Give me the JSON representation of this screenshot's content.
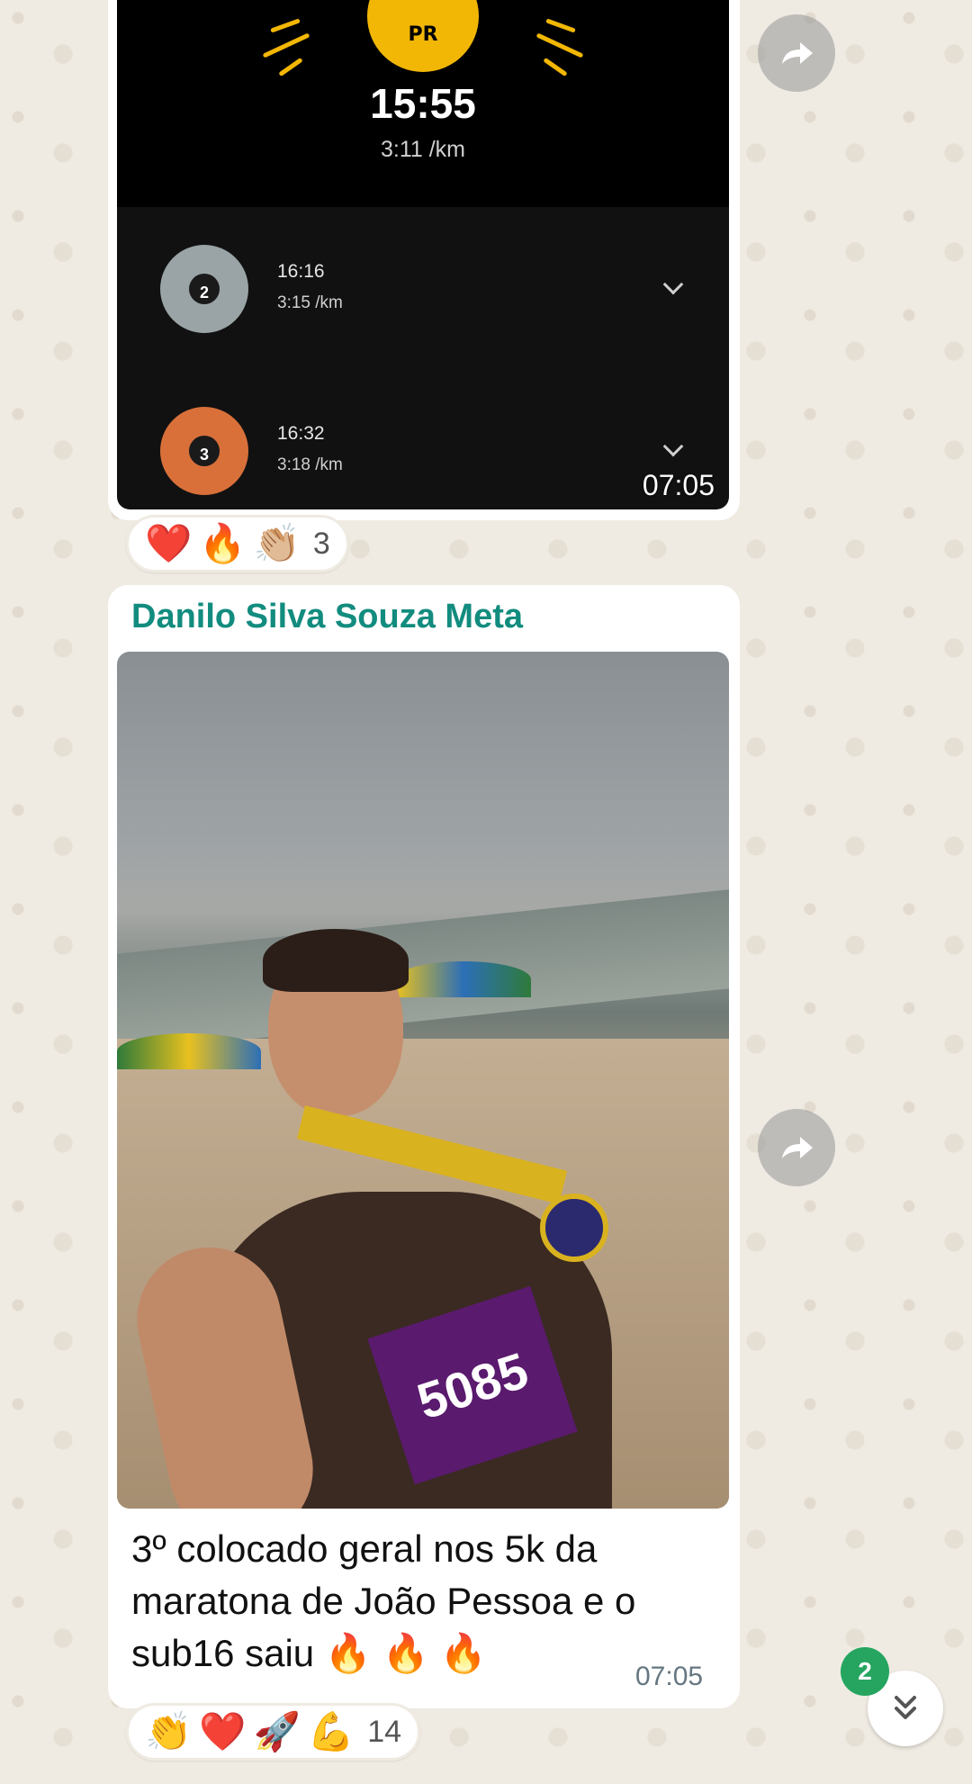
{
  "message1": {
    "stats": {
      "badge_label": "PR",
      "best_time": "15:55",
      "best_pace": "3:11 /km",
      "rows": [
        {
          "rank": "2",
          "time": "16:16",
          "pace": "3:15 /km",
          "medal_color": "#9aa3a5"
        },
        {
          "rank": "3",
          "time": "16:32",
          "pace": "3:18 /km",
          "medal_color": "#d9703a"
        }
      ]
    },
    "timestamp": "07:05",
    "reactions": {
      "emojis": [
        "❤️",
        "🔥",
        "👏🏼"
      ],
      "count": "3"
    }
  },
  "message2": {
    "sender": "Danilo Silva Souza Meta",
    "photo_bib_number": "5085",
    "caption": "3º colocado geral nos 5k da maratona de João Pessoa e o sub16 saiu 🔥 🔥 🔥",
    "timestamp": "07:05",
    "reactions": {
      "emojis": [
        "👏",
        "❤️",
        "🚀",
        "💪"
      ],
      "count": "14"
    }
  },
  "scroll": {
    "unread_count": "2"
  },
  "colors": {
    "sender": "#128c7e",
    "accent_gold": "#f2b705",
    "unread_badge": "#25a55f",
    "wallpaper": "#efeae2"
  },
  "icons": [
    "forward-icon",
    "chevron-down-icon",
    "double-chevron-down-icon"
  ]
}
